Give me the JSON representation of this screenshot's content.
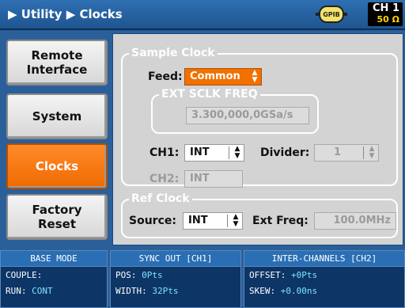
{
  "header": {
    "breadcrumb": "▶ Utility ▶ Clocks",
    "gpib_label": "GPIB",
    "channel": "CH 1",
    "impedance": "50 Ω"
  },
  "nav": {
    "remote_interface": "Remote Interface",
    "system": "System",
    "clocks": "Clocks",
    "factory_reset": "Factory Reset"
  },
  "sample_clock": {
    "title": "Sample Clock",
    "feed_label": "Feed:",
    "feed_value": "Common",
    "ext_sclk_title": "EXT SCLK FREQ",
    "ext_sclk_value": "3.300,000,0GSa/s",
    "ch1_label": "CH1:",
    "ch1_value": "INT",
    "divider_label": "Divider:",
    "divider_value": "1",
    "ch2_label": "CH2:",
    "ch2_value": "INT"
  },
  "ref_clock": {
    "title": "Ref Clock",
    "source_label": "Source:",
    "source_value": "INT",
    "ext_freq_label": "Ext Freq:",
    "ext_freq_value": "100.0MHz"
  },
  "status": {
    "base_mode": {
      "title": "BASE MODE",
      "couple_label": "COUPLE:",
      "couple_value": "",
      "run_label": "RUN:",
      "run_value": "CONT"
    },
    "sync_out": {
      "title": "SYNC OUT [CH1]",
      "pos_label": "POS:",
      "pos_value": "0Pts",
      "width_label": "WIDTH:",
      "width_value": "32Pts"
    },
    "inter_channels": {
      "title": "INTER-CHANNELS [CH2]",
      "offset_label": "OFFSET:",
      "offset_value": "+0Pts",
      "skew_label": "SKEW:",
      "skew_value": "+0.00ns"
    }
  }
}
